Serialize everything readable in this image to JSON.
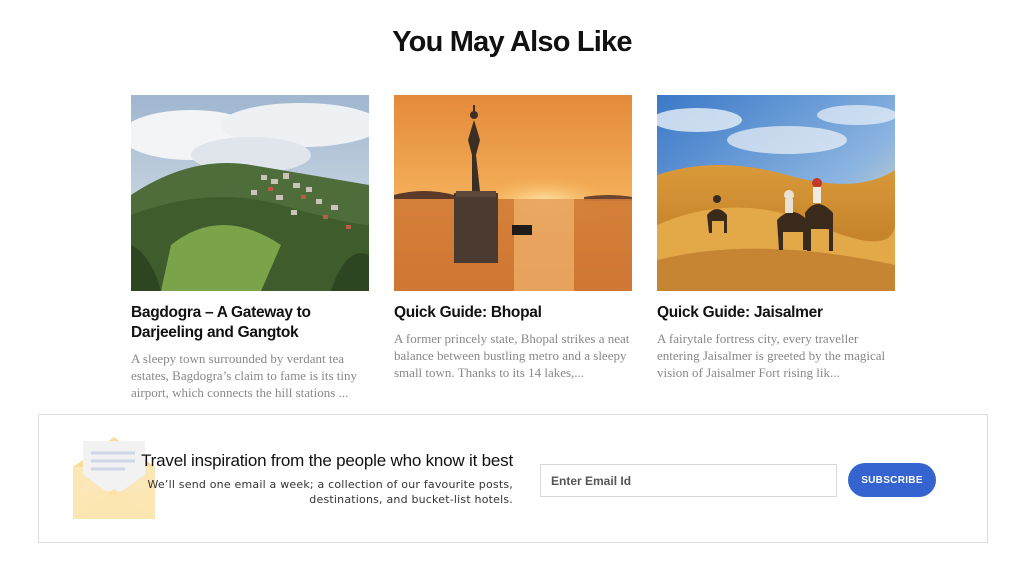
{
  "section": {
    "title": "You May Also Like"
  },
  "cards": [
    {
      "image": "darjeeling-hillside-town-photo",
      "title": "Bagdogra – A Gateway to Darjeeling and Gangtok",
      "excerpt": "A sleepy town surrounded by verdant tea estates, Bagdogra’s claim to fame is its tiny airport, which connects the hill stations ..."
    },
    {
      "image": "bhopal-lake-statue-sunset-photo",
      "title": "Quick Guide: Bhopal",
      "excerpt": "A former princely state, Bhopal strikes a neat balance between bustling metro and a sleepy small town. Thanks to its 14 lakes,..."
    },
    {
      "image": "jaisalmer-desert-camels-photo",
      "title": "Quick Guide: Jaisalmer",
      "excerpt": "A fairytale fortress city, every traveller entering Jaisalmer is greeted by the magical vision of Jaisalmer Fort rising lik..."
    }
  ],
  "newsletter": {
    "icon": "envelope-icon",
    "heading": "Travel inspiration from the people who know it best",
    "subtext": "We’ll send one email a week; a collection of our favourite posts, destinations, and bucket-list hotels.",
    "email_placeholder": "Enter Email Id",
    "subscribe_label": "SUBSCRIBE"
  },
  "colors": {
    "accent": "#3564d1",
    "border": "#dcdcdc",
    "excerpt": "#888888"
  }
}
